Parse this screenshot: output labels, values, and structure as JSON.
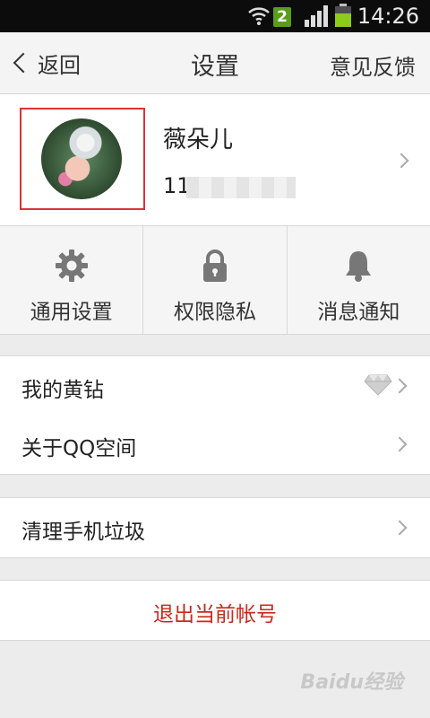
{
  "status_bar": {
    "time": "14:26",
    "sim_badge": "2"
  },
  "header": {
    "back_label": "返回",
    "title": "设置",
    "feedback_label": "意见反馈"
  },
  "profile": {
    "nickname": "薇朵儿",
    "qq_number_visible": "11"
  },
  "quick_settings": [
    {
      "label": "通用设置",
      "icon": "gear-icon"
    },
    {
      "label": "权限隐私",
      "icon": "lock-icon"
    },
    {
      "label": "消息通知",
      "icon": "bell-icon"
    }
  ],
  "menu": {
    "yellow_diamond": "我的黄钻",
    "about": "关于QQ空间",
    "clean": "清理手机垃圾",
    "logout": "退出当前帐号"
  },
  "watermark": "Baidu经验",
  "colors": {
    "logout_text": "#c82a1e",
    "highlight_box": "#dd3333",
    "sim_badge": "#5a9c1c"
  }
}
